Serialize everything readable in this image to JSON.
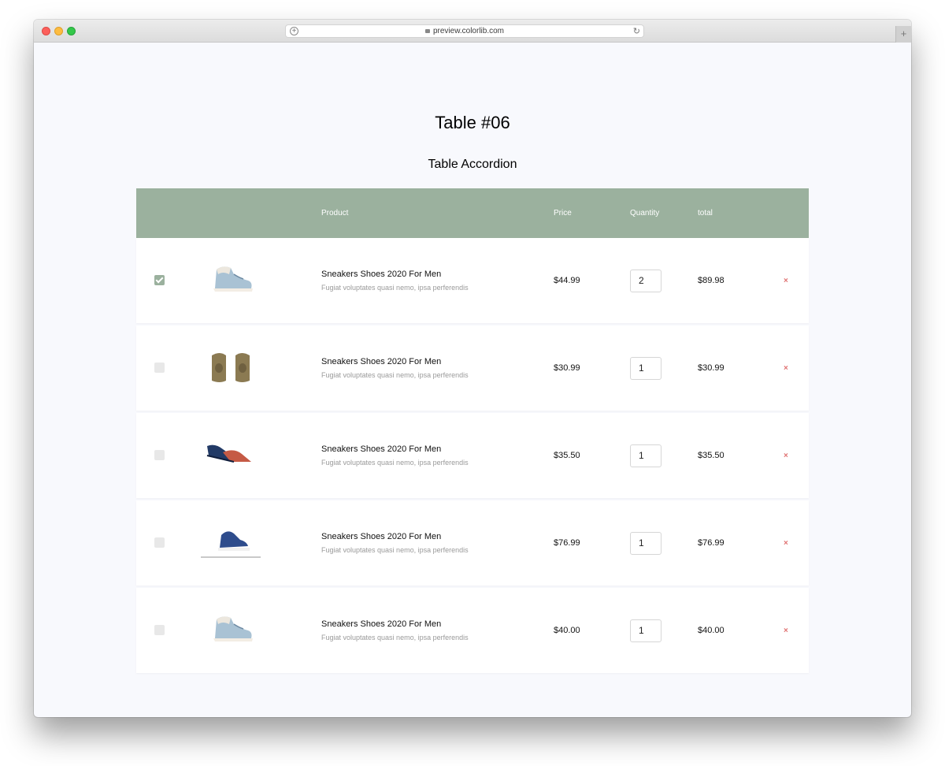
{
  "browser": {
    "url": "preview.colorlib.com",
    "new_tab_label": "+",
    "reload_glyph": "↻",
    "plus_glyph": "+"
  },
  "page": {
    "title": "Table #06",
    "subtitle": "Table Accordion"
  },
  "table": {
    "headers": {
      "product": "Product",
      "price": "Price",
      "quantity": "Quantity",
      "total": "total"
    },
    "header_color": "#9bb19e",
    "remove_color": "#e07272",
    "rows": [
      {
        "checked": true,
        "image": "white-blue-hightop-sneaker",
        "name": "Sneakers Shoes 2020 For Men",
        "description": "Fugiat voluptates quasi nemo, ipsa perferendis",
        "price": "$44.99",
        "quantity": "2",
        "total": "$89.98",
        "remove": "×"
      },
      {
        "checked": false,
        "image": "brown-pair-sneakers",
        "name": "Sneakers Shoes 2020 For Men",
        "description": "Fugiat voluptates quasi nemo, ipsa perferendis",
        "price": "$30.99",
        "quantity": "1",
        "total": "$30.99",
        "remove": "×"
      },
      {
        "checked": false,
        "image": "navy-red-loafers",
        "name": "Sneakers Shoes 2020 For Men",
        "description": "Fugiat voluptates quasi nemo, ipsa perferendis",
        "price": "$35.50",
        "quantity": "1",
        "total": "$35.50",
        "remove": "×"
      },
      {
        "checked": false,
        "image": "blue-lowtop-sneaker",
        "name": "Sneakers Shoes 2020 For Men",
        "description": "Fugiat voluptates quasi nemo, ipsa perferendis",
        "price": "$76.99",
        "quantity": "1",
        "total": "$76.99",
        "remove": "×"
      },
      {
        "checked": false,
        "image": "white-blue-hightop-sneaker",
        "name": "Sneakers Shoes 2020 For Men",
        "description": "Fugiat voluptates quasi nemo, ipsa perferendis",
        "price": "$40.00",
        "quantity": "1",
        "total": "$40.00",
        "remove": "×"
      }
    ]
  }
}
